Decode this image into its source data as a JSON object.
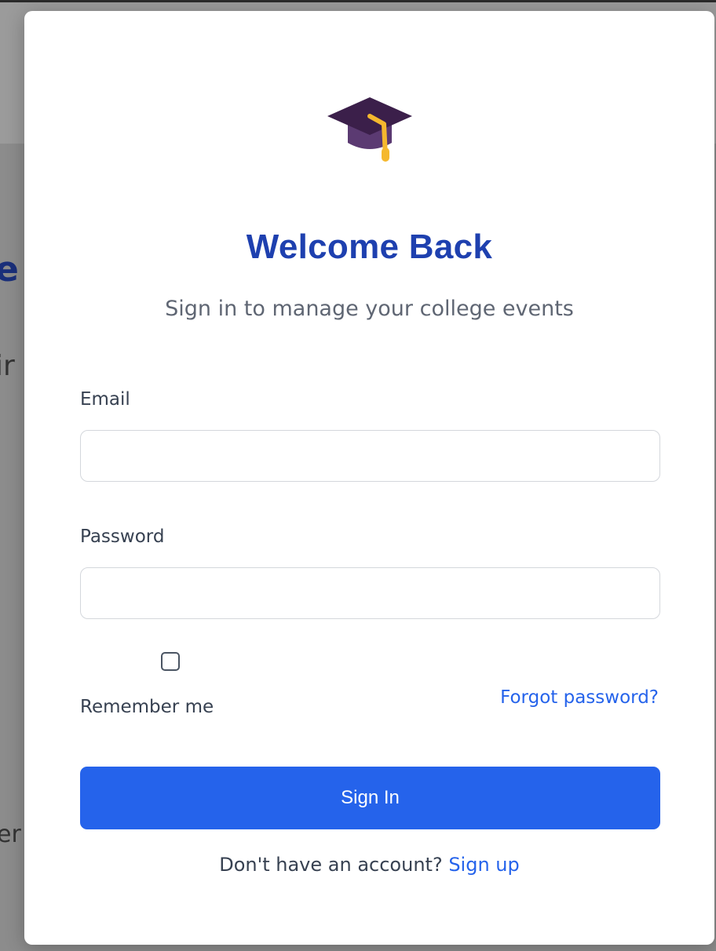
{
  "background": {
    "fragments": [
      "e",
      "ir",
      "er"
    ]
  },
  "modal": {
    "logo_icon": "graduation-cap-icon",
    "title": "Welcome Back",
    "subtitle": "Sign in to manage your college events",
    "email": {
      "label": "Email",
      "value": "",
      "placeholder": ""
    },
    "password": {
      "label": "Password",
      "value": "",
      "placeholder": ""
    },
    "remember": {
      "label": "Remember me",
      "checked": false
    },
    "forgot_link": "Forgot password?",
    "submit_label": "Sign In",
    "signup": {
      "prompt": "Don't have an account?",
      "link": "Sign up"
    }
  },
  "colors": {
    "title": "#1e40af",
    "accent": "#2563eb",
    "cap_dark": "#3b1f4a",
    "cap_band": "#5b3a72",
    "tassel": "#f5b82e"
  }
}
